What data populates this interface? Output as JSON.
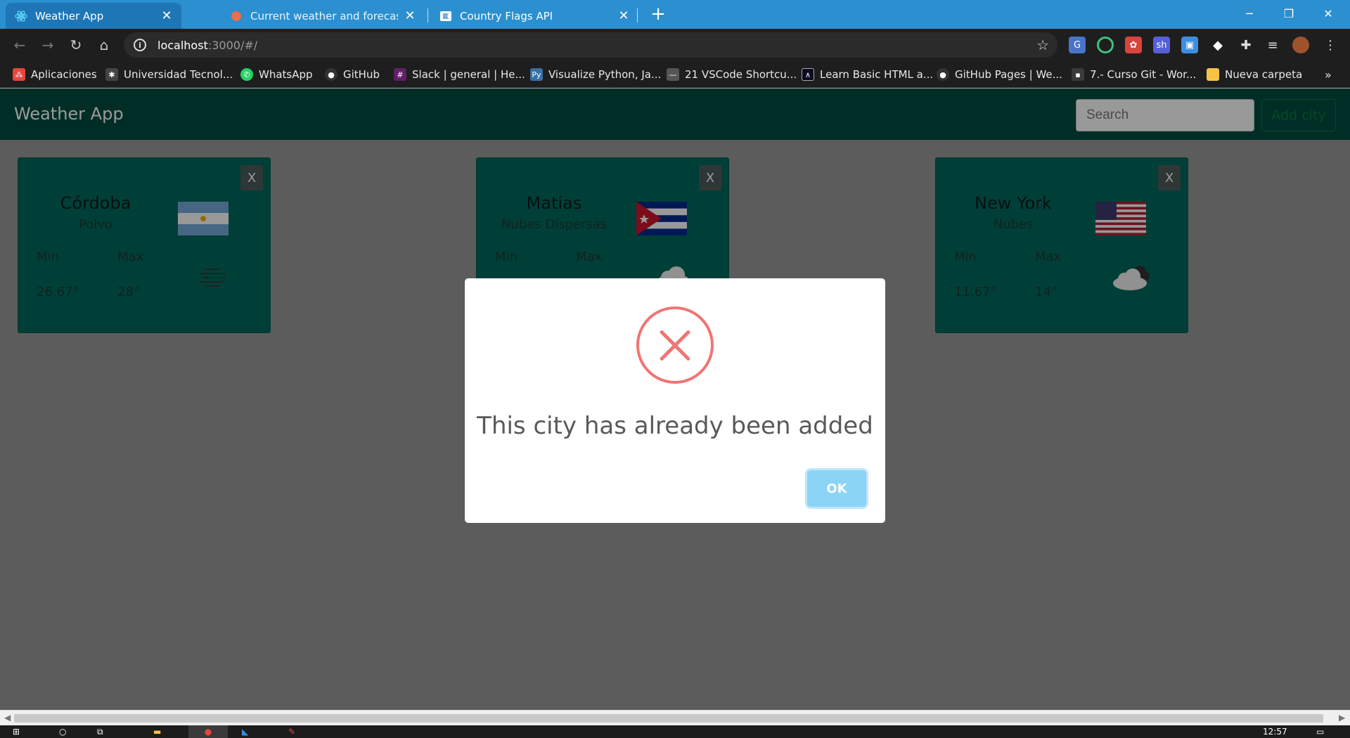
{
  "browser": {
    "tabs": [
      {
        "title": "Weather App",
        "icon": "react-icon",
        "active": true
      },
      {
        "title": "Current weather and forecast - O",
        "icon": "openweather-icon",
        "active": false
      },
      {
        "title": "Country Flags API",
        "icon": "flag-icon",
        "active": false
      }
    ],
    "url": {
      "host": "localhost",
      "rest": ":3000/#/"
    },
    "bookmarks": [
      {
        "label": "Aplicaciones",
        "icon": "apps-grid-icon",
        "color": "#e8453c"
      },
      {
        "label": "Universidad Tecnol...",
        "icon": "university-icon",
        "color": "#444444"
      },
      {
        "label": "WhatsApp",
        "icon": "whatsapp-icon",
        "color": "#25d366"
      },
      {
        "label": "GitHub",
        "icon": "github-icon",
        "color": "#333333"
      },
      {
        "label": "Slack | general | He...",
        "icon": "slack-icon",
        "color": "#611f69"
      },
      {
        "label": "Visualize Python, Ja...",
        "icon": "python-icon",
        "color": "#3572a5"
      },
      {
        "label": "21 VSCode Shortcu...",
        "icon": "dash-icon",
        "color": "#555555"
      },
      {
        "label": "Learn Basic HTML a...",
        "icon": "freecodecamp-icon",
        "color": "#0a0a23"
      },
      {
        "label": "GitHub Pages | We...",
        "icon": "github-icon",
        "color": "#333333"
      },
      {
        "label": "7.- Curso Git - Wor...",
        "icon": "page-icon",
        "color": "#3a3a3a"
      },
      {
        "label": "Nueva carpeta",
        "icon": "folder-icon",
        "color": "#f6c344"
      }
    ],
    "clock": "12:57"
  },
  "app": {
    "brand": "Weather App",
    "search_placeholder": "Search",
    "add_city_label": "Add city",
    "cards": [
      {
        "name": "Córdoba",
        "description": "Polvo",
        "min_label": "Min",
        "max_label": "Max",
        "min": "26.67°",
        "max": "28°",
        "flag": "argentina",
        "weather_icon": "dust-icon",
        "close": "X"
      },
      {
        "name": "Matias",
        "description": "Nubes Dispersas",
        "min_label": "Min",
        "max_label": "Max",
        "min": "",
        "max": "",
        "flag": "cuba",
        "weather_icon": "cloud-icon",
        "close": "X"
      },
      {
        "name": "New York",
        "description": "Nubes",
        "min_label": "Min",
        "max_label": "Max",
        "min": "11.67°",
        "max": "14°",
        "flag": "usa",
        "weather_icon": "cloud-icon",
        "close": "X"
      }
    ]
  },
  "modal": {
    "icon": "error-x-icon",
    "message": "This city has already been added",
    "ok_label": "OK",
    "accent_color": "#f27474",
    "button_color": "#8cd4f5"
  }
}
